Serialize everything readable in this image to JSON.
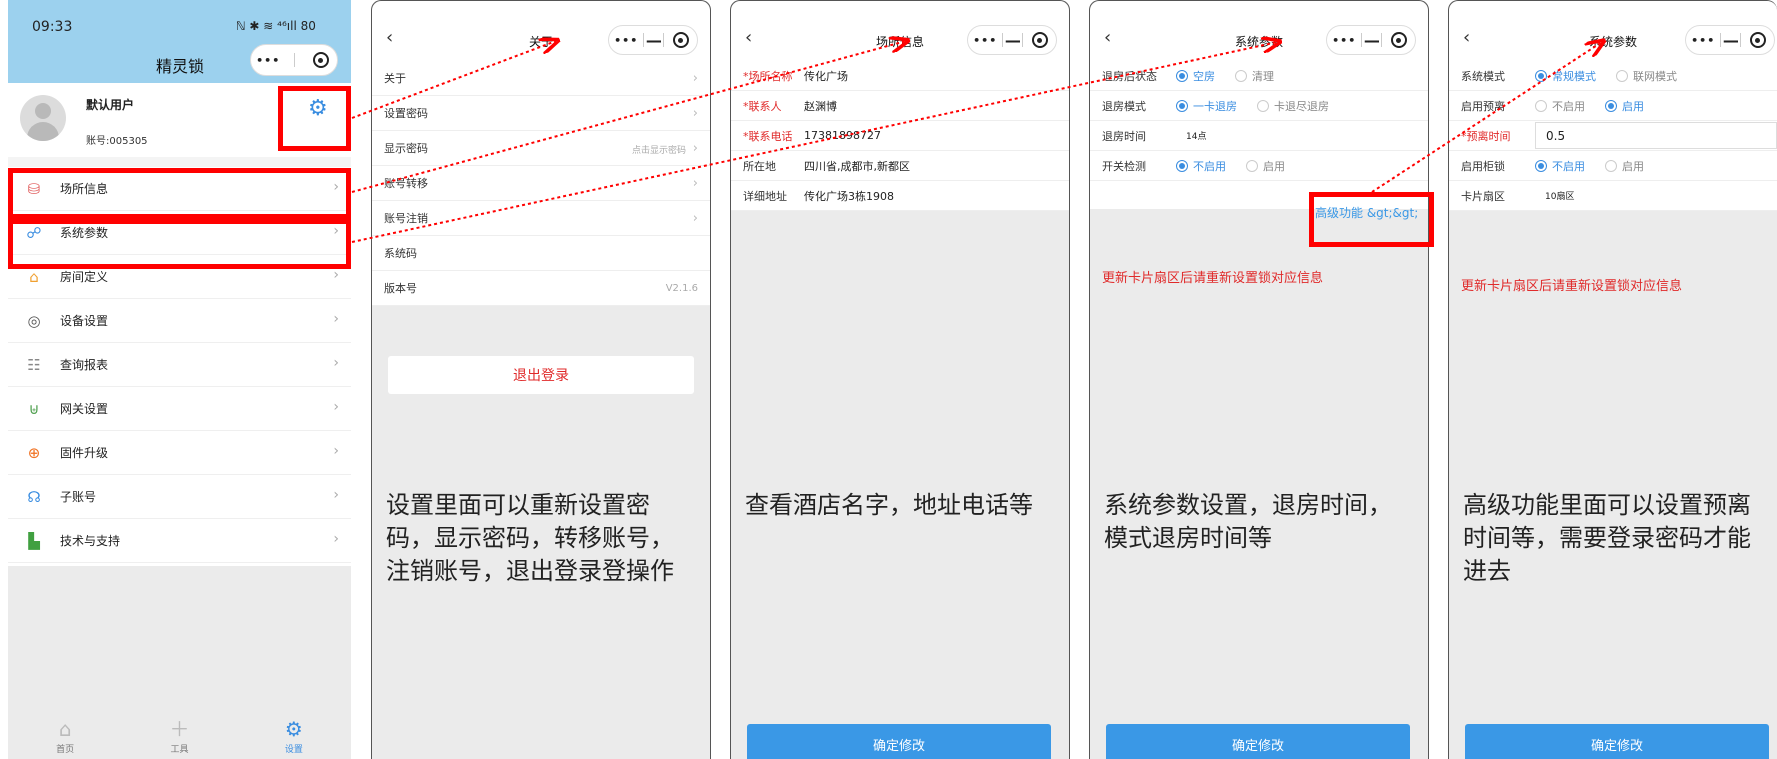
{
  "colors": {
    "accent": "#3a98e6",
    "header": "#9cd1ee",
    "warn": "#e02a2a",
    "highlight": "#ff0000"
  },
  "p1": {
    "time": "09:33",
    "status": "ℕ ✱ ≋ ⁴⁶ıll 80",
    "title": "精灵锁",
    "capsule_dots": "•••",
    "capsule_minus": "—",
    "user_name": "默认用户",
    "account": "账号:005305",
    "menu": [
      {
        "icon": "⛁",
        "label": "场所信息",
        "color": "#e05a5a"
      },
      {
        "icon": "☍",
        "label": "系统参数",
        "color": "#3a8de0"
      },
      {
        "icon": "⌂",
        "label": "房间定义",
        "color": "#f0a030"
      },
      {
        "icon": "◎",
        "label": "设备设置",
        "color": "#555"
      },
      {
        "icon": "☷",
        "label": "查询报表",
        "color": "#888"
      },
      {
        "icon": "⊎",
        "label": "网关设置",
        "color": "#50a050"
      },
      {
        "icon": "⊕",
        "label": "固件升级",
        "color": "#f07020"
      },
      {
        "icon": "☊",
        "label": "子账号",
        "color": "#3a8de0"
      },
      {
        "icon": "▙",
        "label": "技术与支持",
        "color": "#40a040"
      }
    ],
    "tabs": [
      {
        "icon": "⌂",
        "label": "首页"
      },
      {
        "icon": "＋",
        "label": "工具"
      },
      {
        "icon": "⚙",
        "label": "设置"
      }
    ]
  },
  "p2": {
    "title": "关于",
    "rows": [
      {
        "label": "关于",
        "right": ""
      },
      {
        "label": "设置密码",
        "right": ""
      },
      {
        "label": "显示密码",
        "right": "点击显示密码"
      },
      {
        "label": "账号转移",
        "right": ""
      },
      {
        "label": "账号注销",
        "right": ""
      },
      {
        "label": "系统码",
        "right": ""
      },
      {
        "label": "版本号",
        "right": "V2.1.6"
      }
    ],
    "logout": "退出登录",
    "note": "设置里面可以重新设置密码，显示密码，转移账号，注销账号，退出登录登操作"
  },
  "p3": {
    "title": "场所信息",
    "rows": [
      {
        "k": "*场所名称",
        "v": "传化广场",
        "req": true
      },
      {
        "k": "*联系人",
        "v": "赵渊博",
        "req": true
      },
      {
        "k": "*联系电话",
        "v": "17381898727",
        "req": true
      },
      {
        "k": "所在地",
        "v": "四川省,成都市,新都区",
        "req": false
      },
      {
        "k": "详细地址",
        "v": "传化广场3栋1908",
        "req": false
      }
    ],
    "note": "查看酒店名字，地址电话等",
    "button": "确定修改"
  },
  "p4": {
    "title": "系统参数",
    "rows": [
      {
        "k": "退房后状态",
        "opts": [
          "空房",
          "清理"
        ],
        "sel": 0
      },
      {
        "k": "退房模式",
        "opts": [
          "一卡退房",
          "卡退尽退房"
        ],
        "sel": 0
      },
      {
        "k": "退房时间",
        "value": "14点"
      },
      {
        "k": "开关检测",
        "opts": [
          "不启用",
          "启用"
        ],
        "sel": 0
      }
    ],
    "advanced": "高级功能 &gt;&gt;",
    "warn": "更新卡片扇区后请重新设置锁对应信息",
    "note": "系统参数设置，退房时间，模式退房时间等",
    "button": "确定修改"
  },
  "p5": {
    "title": "系统参数",
    "rows": [
      {
        "k": "系统模式",
        "opts": [
          "常规模式",
          "联网模式"
        ],
        "sel": 0
      },
      {
        "k": "启用预离",
        "opts": [
          "不启用",
          "启用"
        ],
        "sel": 1
      },
      {
        "k": "*预离时间",
        "value": "0.5"
      },
      {
        "k": "启用柜锁",
        "opts": [
          "不启用",
          "启用"
        ],
        "sel": 0
      },
      {
        "k": "卡片扇区",
        "value": "10扇区"
      }
    ],
    "warn": "更新卡片扇区后请重新设置锁对应信息",
    "note": "高级功能里面可以设置预离时间等，需要登录密码才能进去",
    "button": "确定修改"
  }
}
